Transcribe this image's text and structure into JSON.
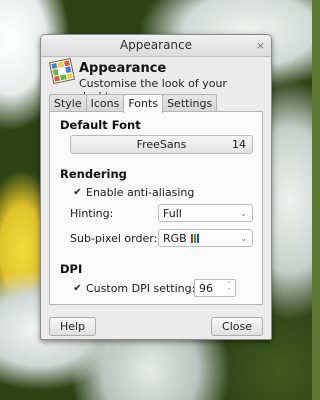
{
  "window": {
    "title": "Appearance",
    "close_glyph": "×"
  },
  "header": {
    "title": "Appearance",
    "subtitle": "Customise the look of your desktop",
    "icon": "appearance-app-icon"
  },
  "tabs": [
    {
      "label": "Style"
    },
    {
      "label": "Icons"
    },
    {
      "label": "Fonts",
      "active": true
    },
    {
      "label": "Settings"
    }
  ],
  "default_font": {
    "heading": "Default Font",
    "font_name": "FreeSans",
    "font_size": "14"
  },
  "rendering": {
    "heading": "Rendering",
    "antialias_label": "Enable anti-aliasing",
    "antialias_checked": true,
    "check_glyph": "✔",
    "hinting_label": "Hinting:",
    "hinting_value": "Full",
    "subpixel_label": "Sub-pixel order:",
    "subpixel_value": "RGB",
    "chevron_glyph": "⌄"
  },
  "dpi": {
    "heading": "DPI",
    "custom_label": "Custom DPI setting:",
    "custom_checked": true,
    "value": "96",
    "up_glyph": "˄",
    "down_glyph": "˅"
  },
  "buttons": {
    "help": "Help",
    "close": "Close"
  },
  "colors": {
    "rgb_red": "#e02020",
    "rgb_green": "#20b020",
    "rgb_blue": "#2040e0"
  }
}
